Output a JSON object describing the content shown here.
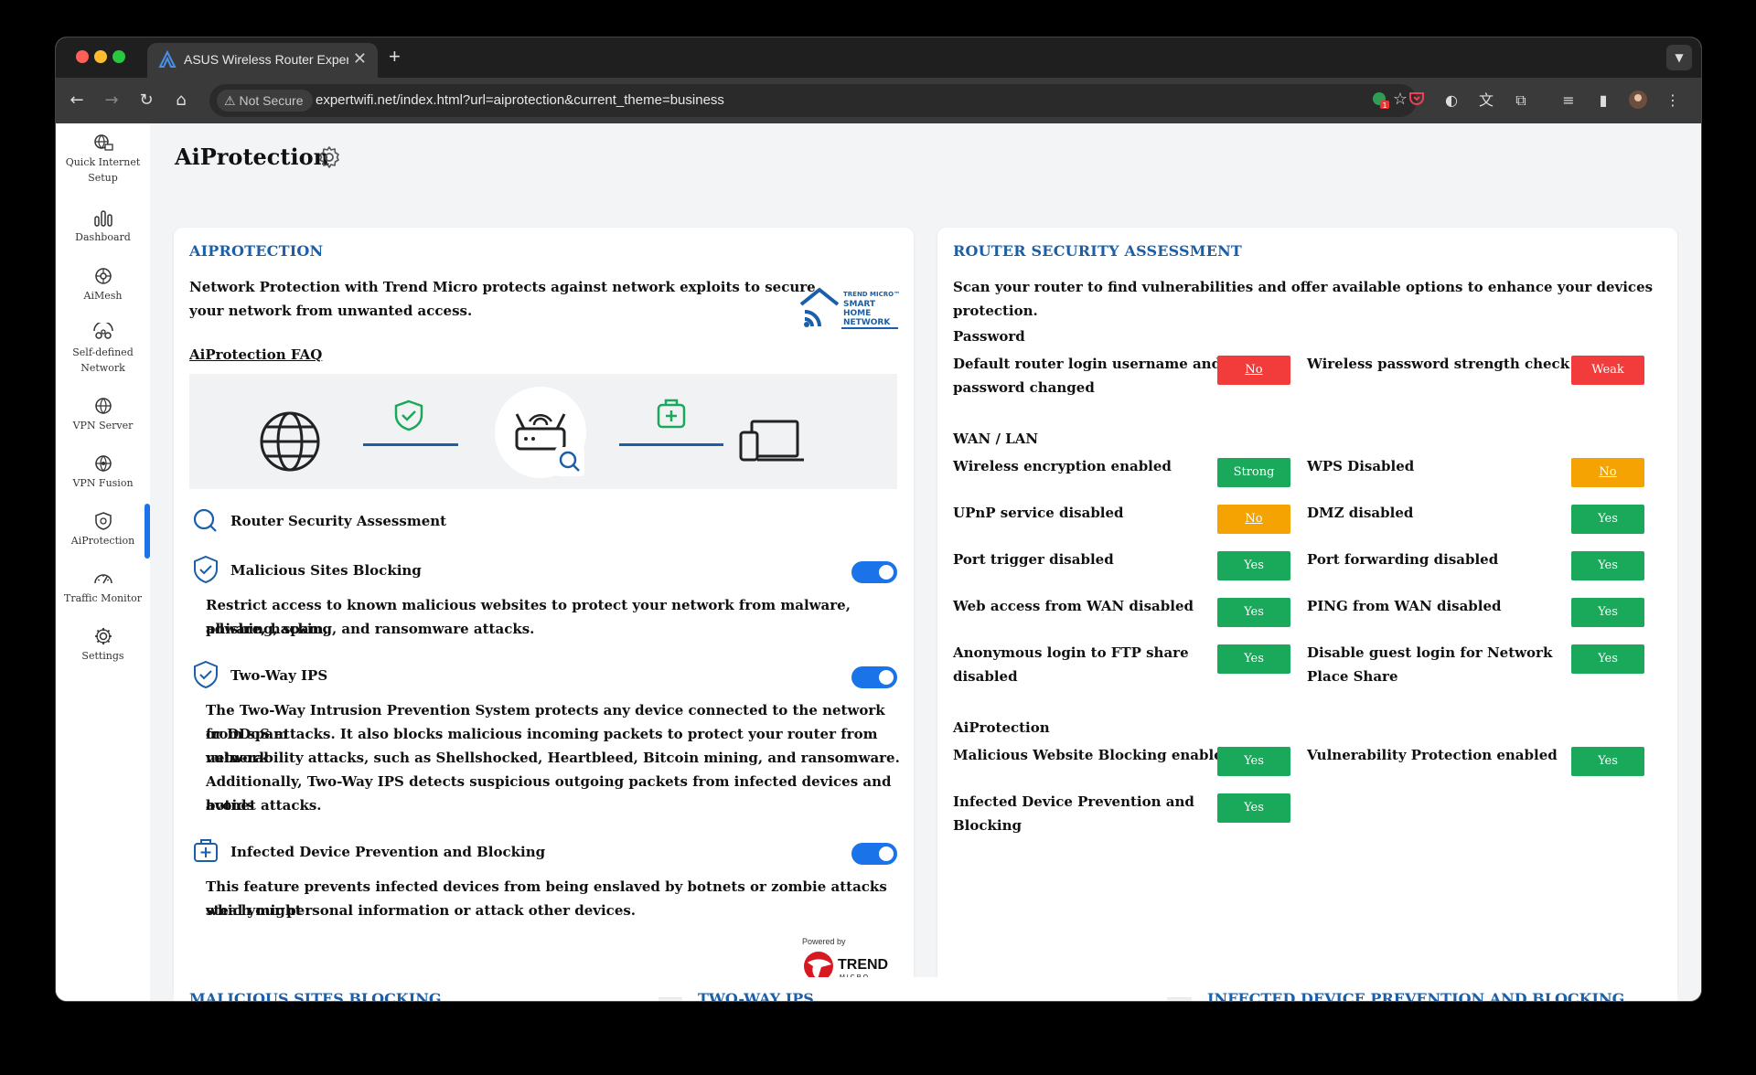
{
  "browser": {
    "tab_title": "ASUS Wireless Router Exper",
    "tab_close": "✕",
    "new_tab": "+",
    "not_secure": "Not Secure",
    "url": "expertwifi.net/index.html?url=aiprotection&current_theme=business",
    "ext_badge": "1"
  },
  "sidebar": {
    "items": [
      {
        "label": "Quick Internet Setup",
        "icon": "globe-setup-icon"
      },
      {
        "label": "Dashboard",
        "icon": "bar-chart-icon"
      },
      {
        "label": "AiMesh",
        "icon": "mesh-icon"
      },
      {
        "label": "Self-defined Network",
        "icon": "network-icon"
      },
      {
        "label": "VPN Server",
        "icon": "vpn-server-icon"
      },
      {
        "label": "VPN Fusion",
        "icon": "vpn-fusion-icon"
      },
      {
        "label": "AiProtection",
        "icon": "shield-icon"
      },
      {
        "label": "Traffic Monitor",
        "icon": "speedometer-icon"
      },
      {
        "label": "Settings",
        "icon": "gear-icon"
      }
    ]
  },
  "page": {
    "title": "AiProtection"
  },
  "aiprotection": {
    "heading": "AIPROTECTION",
    "intro_line1": "Network Protection with Trend Micro protects against network exploits to secure",
    "intro_line2": "your network from unwanted access.",
    "logo_lines": [
      "TREND MICRO™",
      "SMART",
      "HOME",
      "NETWORK"
    ],
    "faq": "AiProtection FAQ",
    "router_assessment": "Router Security Assessment",
    "features": [
      {
        "title": "Malicious Sites Blocking",
        "lines": [
          "Restrict access to known malicious websites to protect your network from malware, phishing, spam,",
          "adware, hacking, and ransomware attacks."
        ],
        "enabled": true
      },
      {
        "title": "Two-Way IPS",
        "lines": [
          "The Two-Way Intrusion Prevention System protects any device connected to the network from spam",
          "or DDoS attacks. It also blocks malicious incoming packets to protect your router from network",
          "vulnerability attacks, such as Shellshocked, Heartbleed, Bitcoin mining, and ransomware.",
          "Additionally, Two-Way IPS detects suspicious outgoing packets from infected devices and avoids",
          "botnet attacks."
        ],
        "enabled": true
      },
      {
        "title": "Infected Device Prevention and Blocking",
        "lines": [
          "This feature prevents infected devices from being enslaved by botnets or zombie attacks which might",
          "steal your personal information or attack other devices."
        ],
        "enabled": true
      }
    ],
    "powered_by": "Powered by",
    "trend_name": "TREND",
    "trend_sub": "M I C R O"
  },
  "assessment": {
    "heading": "ROUTER SECURITY ASSESSMENT",
    "intro": "Scan your router to find vulnerabilities and offer available options to enhance your devices protection.",
    "sections": {
      "password": "Password",
      "wanlan": "WAN / LAN",
      "aiprotection": "AiProtection"
    },
    "items": {
      "default_login_l1": "Default router login username and",
      "default_login_l2": "password changed",
      "default_login_val": "No",
      "wifi_pw_strength": "Wireless password strength check",
      "wifi_pw_strength_val": "Weak",
      "wireless_enc": "Wireless encryption enabled",
      "wireless_enc_val": "Strong",
      "wps": "WPS Disabled",
      "wps_val": "No",
      "upnp": "UPnP service disabled",
      "upnp_val": "No",
      "dmz": "DMZ disabled",
      "dmz_val": "Yes",
      "port_trigger": "Port trigger disabled",
      "port_trigger_val": "Yes",
      "port_fwd": "Port forwarding disabled",
      "port_fwd_val": "Yes",
      "web_wan": "Web access from WAN disabled",
      "web_wan_val": "Yes",
      "ping_wan": "PING from WAN disabled",
      "ping_wan_val": "Yes",
      "ftp_l1": "Anonymous login to FTP share",
      "ftp_l2": "disabled",
      "ftp_val": "Yes",
      "guest_l1": "Disable guest login for Network",
      "guest_l2": "Place Share",
      "guest_val": "Yes",
      "mal_web": "Malicious Website Blocking enabled",
      "mal_web_val": "Yes",
      "vuln": "Vulnerability Protection enabled",
      "vuln_val": "Yes",
      "infected_l1": "Infected Device Prevention and",
      "infected_l2": "Blocking",
      "infected_val": "Yes"
    }
  },
  "bottom_cards": [
    "MALICIOUS SITES BLOCKING",
    "TWO-WAY IPS",
    "INFECTED DEVICE PREVENTION AND BLOCKING"
  ],
  "colors": {
    "red": "#f23b3b",
    "orange": "#f5a302",
    "green": "#1aa85a",
    "accent": "#1a73e8",
    "heading": "#1a5fa8"
  }
}
